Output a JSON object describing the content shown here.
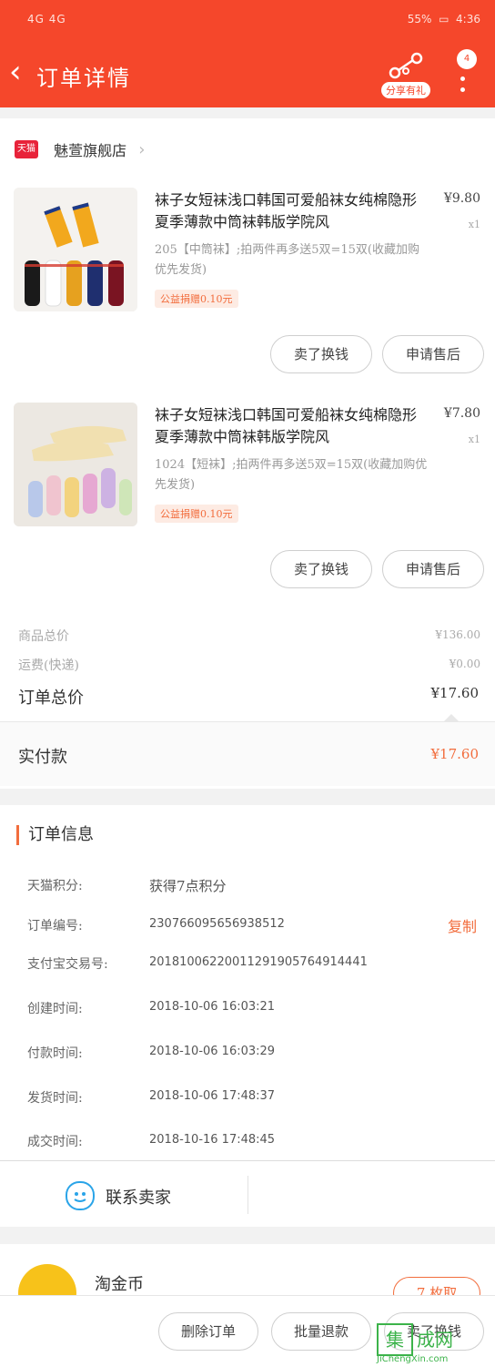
{
  "status_bar": {
    "left": "4G 4G",
    "battery": "55%",
    "time": "4:36"
  },
  "header": {
    "title": "订单详情",
    "share_label": "分享有礼",
    "badge": "4"
  },
  "shop": {
    "logo_text": "天猫",
    "name": "魅萱旗舰店"
  },
  "items": [
    {
      "name": "袜子女短袜浅口韩国可爱船袜女纯棉隐形夏季薄款中筒袜韩版学院风",
      "price": "¥9.80",
      "qty": "x1",
      "sku": "205【中筒袜】;拍两件再多送5双=15双(收藏加购优先发货)",
      "charity": "公益捐赠0.10元",
      "actions": [
        "卖了换钱",
        "申请售后"
      ]
    },
    {
      "name": "袜子女短袜浅口韩国可爱船袜女纯棉隐形夏季薄款中筒袜韩版学院风",
      "price": "¥7.80",
      "qty": "x1",
      "sku": "1024【短袜】;拍两件再多送5双=15双(收藏加购优先发货)",
      "charity": "公益捐赠0.10元",
      "actions": [
        "卖了换钱",
        "申请售后"
      ]
    }
  ],
  "summary": {
    "goods_label": "商品总价",
    "goods_value": "¥136.00",
    "shipping_label": "运费(快递)",
    "shipping_value": "¥0.00",
    "total_label": "订单总价",
    "total_value": "¥17.60",
    "paid_label": "实付款",
    "paid_value": "¥17.60"
  },
  "order_info": {
    "heading": "订单信息",
    "rows": [
      {
        "label": "天猫积分:",
        "value": "获得7点积分"
      },
      {
        "label": "订单编号:",
        "value": "230766095656938512"
      },
      {
        "label": "支付宝交易号:",
        "value": "20181006220011291905764914441"
      },
      {
        "label": "创建时间:",
        "value": "2018-10-06 16:03:21"
      },
      {
        "label": "付款时间:",
        "value": "2018-10-06 16:03:29"
      },
      {
        "label": "发货时间:",
        "value": "2018-10-06 17:48:37"
      },
      {
        "label": "成交时间:",
        "value": "2018-10-16 17:48:45"
      }
    ],
    "copy_label": "复制"
  },
  "contact": {
    "label": "联系卖家"
  },
  "coin": {
    "name": "淘金币",
    "button": "7 枚取"
  },
  "bottom_actions": [
    "删除订单",
    "批量退款",
    "卖了换钱"
  ],
  "watermark": {
    "box": "集",
    "text": "成网",
    "url": "JiChengXin.com"
  },
  "colors": {
    "brand": "#f5472b",
    "accent": "#f26d3d"
  }
}
